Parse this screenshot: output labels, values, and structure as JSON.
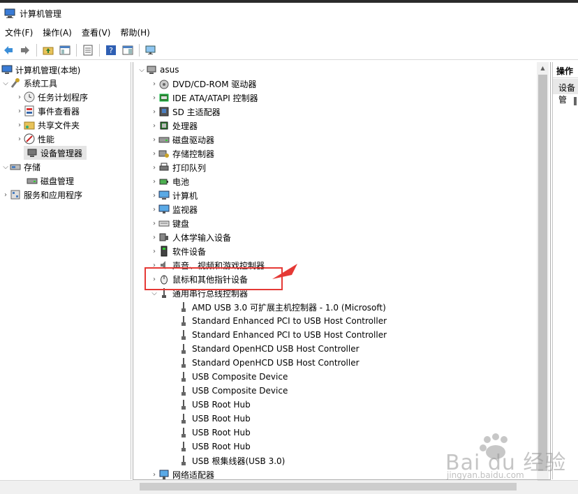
{
  "window": {
    "title": "计算机管理"
  },
  "menu": {
    "items": [
      "文件(F)",
      "操作(A)",
      "查看(V)",
      "帮助(H)"
    ]
  },
  "left_tree": {
    "root": "计算机管理(本地)",
    "system_tools": "系统工具",
    "task_scheduler": "任务计划程序",
    "event_viewer": "事件查看器",
    "shared_folders": "共享文件夹",
    "performance": "性能",
    "device_manager": "设备管理器",
    "storage": "存储",
    "disk_management": "磁盘管理",
    "services_apps": "服务和应用程序"
  },
  "device_tree": {
    "root": "asus",
    "categories": [
      "DVD/CD-ROM 驱动器",
      "IDE ATA/ATAPI 控制器",
      "SD 主适配器",
      "处理器",
      "磁盘驱动器",
      "存储控制器",
      "打印队列",
      "电池",
      "计算机",
      "监视器",
      "键盘",
      "人体学输入设备",
      "软件设备",
      "声音、视频和游戏控制器",
      "鼠标和其他指针设备",
      "通用串行总线控制器"
    ],
    "usb_children": [
      "AMD USB 3.0 可扩展主机控制器 - 1.0 (Microsoft)",
      "Standard Enhanced PCI to USB Host Controller",
      "Standard Enhanced PCI to USB Host Controller",
      "Standard OpenHCD USB Host Controller",
      "Standard OpenHCD USB Host Controller",
      "USB Composite Device",
      "USB Composite Device",
      "USB Root Hub",
      "USB Root Hub",
      "USB Root Hub",
      "USB Root Hub",
      "USB 根集线器(USB 3.0)"
    ],
    "network_adapters": "网络适配器"
  },
  "actions_pane": {
    "title": "操作",
    "subtitle": "设备管"
  },
  "watermark": {
    "brand": "Bai du 经验",
    "url": "jingyan.baidu.com"
  },
  "colors": {
    "highlight": "#e53935",
    "selection": "#e5e5e5",
    "accent": "#0078d7"
  }
}
